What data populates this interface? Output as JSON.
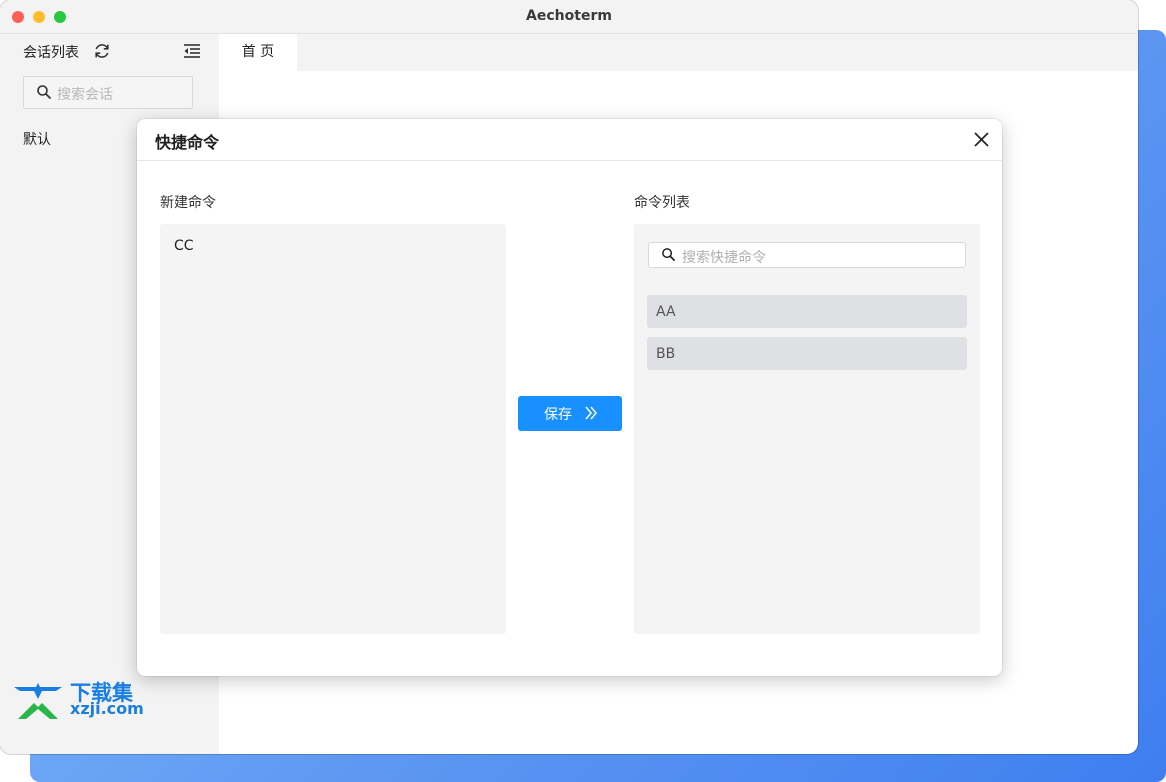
{
  "window": {
    "title": "Aechoterm"
  },
  "sidebar": {
    "header": "会话列表",
    "search_placeholder": "搜索会话",
    "items": [
      {
        "label": "默认"
      }
    ]
  },
  "tabs": [
    {
      "label": "首 页"
    }
  ],
  "modal": {
    "title": "快捷命令",
    "new_command": {
      "label": "新建命令",
      "value": "CC"
    },
    "save_button": "保存",
    "command_list": {
      "label": "命令列表",
      "search_placeholder": "搜索快捷命令",
      "items": [
        {
          "label": "AA"
        },
        {
          "label": "BB"
        }
      ]
    }
  },
  "watermark": {
    "line1": "下载集",
    "line2": "xzji.com"
  },
  "colors": {
    "accent": "#1890ff",
    "close": "#fe5f57",
    "minimize": "#febc2e",
    "maximize": "#28c840",
    "watermark": "#1a7ee0"
  },
  "icons": [
    "refresh-icon",
    "collapse-menu-icon",
    "search-icon",
    "close-icon",
    "double-chevron-right-icon",
    "watermark-logo-icon"
  ]
}
